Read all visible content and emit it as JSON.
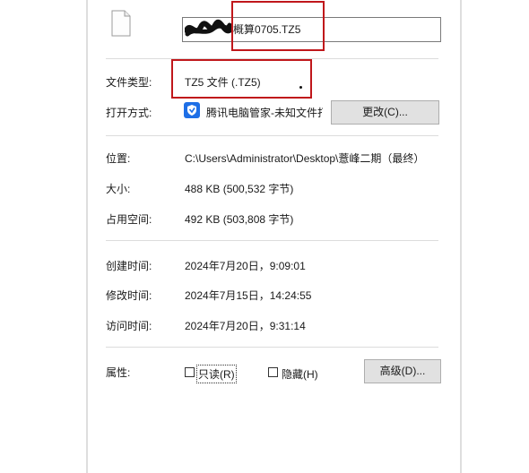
{
  "file": {
    "name_visible": "概算0705.TZ5",
    "type_label": "文件类型:",
    "type_value": "TZ5 文件 (.TZ5)",
    "opens_with_label": "打开方式:",
    "opens_with_app": "腾讯电脑管家-未知文件打开助手",
    "change_button": "更改(C)...",
    "location_label": "位置:",
    "location_value": "C:\\Users\\Administrator\\Desktop\\薏峰二期（最终）",
    "size_label": "大小:",
    "size_value": "488 KB (500,532 字节)",
    "disk_size_label": "占用空间:",
    "disk_size_value": "492 KB (503,808 字节)",
    "created_label": "创建时间:",
    "created_value": "2024年7月20日，9:09:01",
    "modified_label": "修改时间:",
    "modified_value": "2024年7月15日，14:24:55",
    "accessed_label": "访问时间:",
    "accessed_value": "2024年7月20日，9:31:14",
    "attributes_label": "属性:",
    "readonly_label": "只读(R)",
    "hidden_label": "隐藏(H)",
    "advanced_button": "高级(D)..."
  },
  "state": {
    "readonly_checked": false,
    "hidden_checked": false
  },
  "colors": {
    "highlight_border": "#c0171b",
    "button_bg": "#e1e1e1",
    "separator": "#dcdcdc",
    "tencent_blue": "#1e6fe6"
  }
}
